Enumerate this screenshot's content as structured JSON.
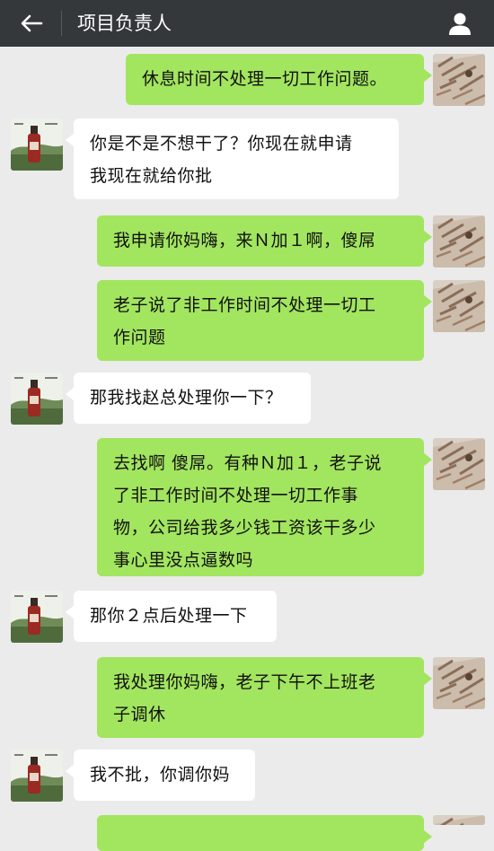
{
  "header": {
    "title": "项目负责人",
    "back_icon": "back-arrow-icon",
    "profile_icon": "person-icon"
  },
  "colors": {
    "header_bg": "#34383b",
    "chat_bg": "#ebebeb",
    "my_bubble": "#a2e55f",
    "other_bubble": "#ffffff"
  },
  "messages": [
    {
      "sender": "me",
      "lines": [
        "休息时间不处理一切工作问题。"
      ]
    },
    {
      "sender": "other",
      "lines": [
        "你是不是不想干了？你现在就申请",
        "我现在就给你批"
      ]
    },
    {
      "sender": "me",
      "lines": [
        "我申请你妈嗨，来Ｎ加１啊，傻屌"
      ]
    },
    {
      "sender": "me",
      "lines": [
        "老子说了非工作时间不处理一切工",
        "作问题"
      ]
    },
    {
      "sender": "other",
      "lines": [
        "那我找赵总处理你一下？"
      ]
    },
    {
      "sender": "me",
      "lines": [
        "去找啊 傻屌。有种Ｎ加１，老子说",
        "了非工作时间不处理一切工作事",
        "物，公司给我多少钱工资该干多少",
        "事心里没点逼数吗"
      ]
    },
    {
      "sender": "other",
      "lines": [
        "那你２点后处理一下"
      ]
    },
    {
      "sender": "me",
      "lines": [
        "我处理你妈嗨，老子下午不上班老",
        "子调休"
      ]
    },
    {
      "sender": "other",
      "lines": [
        "我不批，你调你妈"
      ]
    },
    {
      "sender": "me",
      "lines": [
        ""
      ]
    }
  ]
}
